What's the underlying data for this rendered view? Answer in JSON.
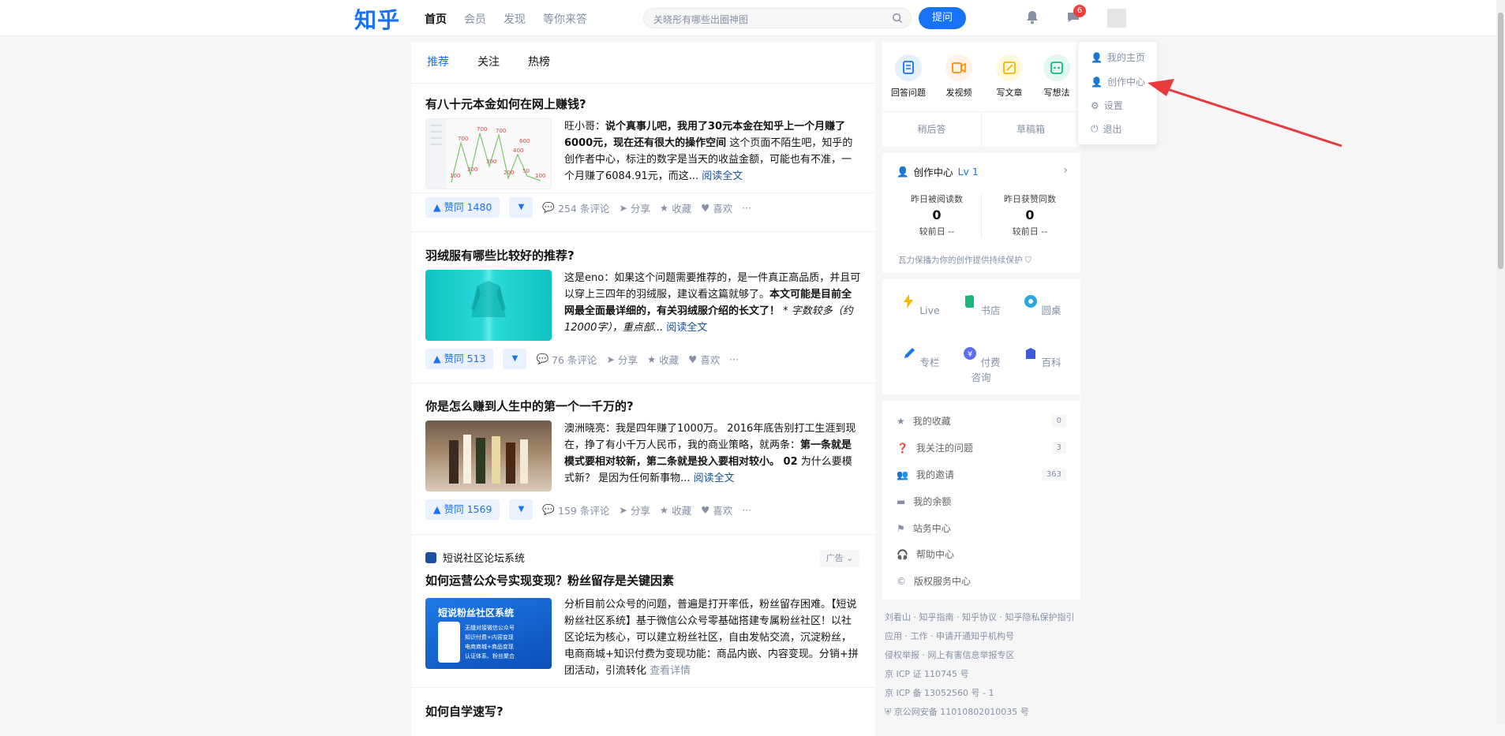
{
  "header": {
    "logo": "知乎",
    "nav": [
      "首页",
      "会员",
      "发现",
      "等你来答"
    ],
    "search_placeholder": "关晓彤有哪些出圈神图",
    "ask_label": "提问",
    "message_badge": "6"
  },
  "feed": {
    "tabs": [
      "推荐",
      "关注",
      "热榜"
    ],
    "cards": [
      {
        "title": "有八十元本金如何在网上赚钱?",
        "author": "旺小哥：",
        "bold": "说个真事儿吧，我用了30元本金在知乎上一个月赚了6000元，现在还有很大的操作空间",
        "text": "这个页面不陌生吧，知乎的创作者中心，标注的数字是当天的收益金额，可能也有不准，一个月赚了6084.91元，而这...",
        "read_more": "阅读全文",
        "votes": "赞同 1480",
        "comments": "254 条评论",
        "share": "分享",
        "favorite": "收藏",
        "like": "喜欢",
        "more": "···",
        "chart_labels": [
          "700",
          "700",
          "700",
          "400",
          "600",
          "300",
          "300",
          "200",
          "100",
          "50",
          "100"
        ]
      },
      {
        "title": "羽绒服有哪些比较好的推荐?",
        "author": "这是eno：",
        "text1": "如果这个问题需要推荐的，是一件真正高品质，并且可以穿上三四年的羽绒服，建议看这篇就够了。",
        "bold": "本文可能是目前全网最全面最详细的，有关羽绒服介绍的长文了！",
        "italic": "* 字数较多（约12000字），重点部...",
        "read_more": "阅读全文",
        "votes": "赞同 513",
        "comments": "76 条评论",
        "share": "分享",
        "favorite": "收藏",
        "like": "喜欢",
        "more": "···"
      },
      {
        "title": "你是怎么赚到人生中的第一个一千万的?",
        "author": "澳洲晓亮：",
        "text1": "我是四年赚了1000万。 2016年底告别打工生涯到现在，挣了有小千万人民币，我的商业策略，就两条：",
        "bold": "第一条就是模式要相对较新，第二条就是投入要相对较小。 02",
        "text2": "为什么要模式新？ 是因为任何新事物...",
        "read_more": "阅读全文",
        "votes": "赞同 1569",
        "comments": "159 条评论",
        "share": "分享",
        "favorite": "收藏",
        "like": "喜欢",
        "more": "···"
      },
      {
        "source": "短说社区论坛系统",
        "ad_tag": "广告",
        "title": "如何运营公众号实现变现？粉丝留存是关键因素",
        "text": "分析目前公众号的问题，普遍是打开率低，粉丝留存困难。【短说粉丝社区系统】基于微信公众号零基础搭建专属粉丝社区！以社区论坛为核心，可以建立粉丝社区，自由发帖交流，沉淀粉丝，电商商城+知识付费为变现功能：商品内嵌、内容变现。分销+拼团活动，引流转化",
        "read_more": "查看详情",
        "thumb_title": "短说粉丝社区系统",
        "thumb_lines": [
          "无缝对接微信公众号",
          "知识付费+内容变现",
          "电商商城+商品变现",
          "认证体系、粉丝聚合"
        ]
      },
      {
        "title": "如何自学速写?"
      }
    ]
  },
  "quick": {
    "items": [
      "回答问题",
      "发视频",
      "写文章",
      "写想法"
    ],
    "subs": [
      "稍后答",
      "草稿箱"
    ]
  },
  "creator": {
    "title": "创作中心",
    "level": "Lv 1",
    "stats": [
      {
        "label": "昨日被阅读数",
        "value": "0",
        "sub": "较前日 --"
      },
      {
        "label": "昨日获赞同数",
        "value": "0",
        "sub": "较前日 --"
      }
    ],
    "note": "瓦力保播为你的创作提供持续保护"
  },
  "services": [
    "Live",
    "书店",
    "圆桌",
    "专栏",
    "付费咨询",
    "百科"
  ],
  "links": [
    {
      "label": "我的收藏",
      "count": "0"
    },
    {
      "label": "我关注的问题",
      "count": "3"
    },
    {
      "label": "我的邀请",
      "count": "363"
    },
    {
      "label": "我的余额",
      "count": ""
    },
    {
      "label": "站务中心",
      "count": ""
    },
    {
      "label": "帮助中心",
      "count": ""
    },
    {
      "label": "版权服务中心",
      "count": ""
    }
  ],
  "footer": [
    "刘看山 · 知乎指南 · 知乎协议 · 知乎隐私保护指引",
    "应用 · 工作 · 申请开通知乎机构号",
    "侵权举报 · 网上有害信息举报专区",
    "京 ICP 证 110745 号",
    "京 ICP 备 13052560 号 - 1",
    "京公网安备 11010802010035 号"
  ],
  "dropdown": [
    "我的主页",
    "创作中心",
    "设置",
    "退出"
  ]
}
